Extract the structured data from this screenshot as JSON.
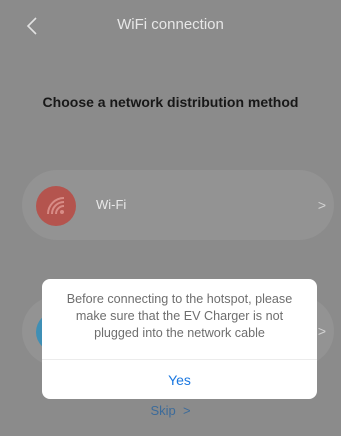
{
  "header": {
    "title": "WiFi connection",
    "back_icon": "chevron-left-icon"
  },
  "subtitle": "Choose a network distribution method",
  "options": [
    {
      "label": "Wi-Fi",
      "icon": "wifi-icon",
      "icon_color": "#b4544e",
      "arrow": ">"
    },
    {
      "label": "",
      "icon": "hotspot-icon",
      "icon_color": "#3f8fb5",
      "arrow": ">"
    }
  ],
  "skip": {
    "label": "Skip",
    "arrow": ">"
  },
  "dialog": {
    "message": "Before connecting to the hotspot, please make sure that the EV Charger is not plugged into the network cable",
    "confirm_label": "Yes",
    "accent": "#1b78e0"
  }
}
